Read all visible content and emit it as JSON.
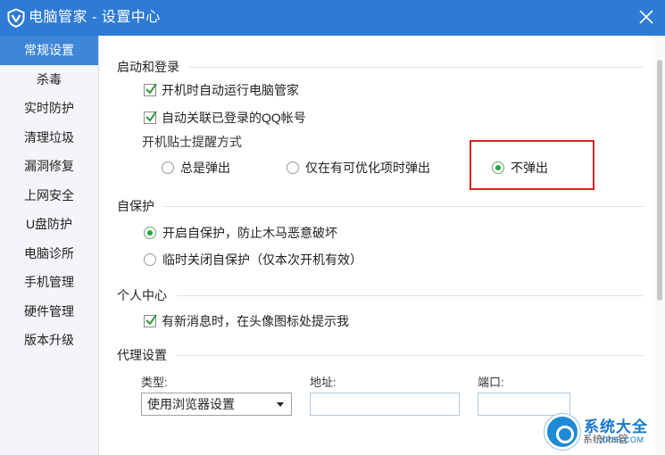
{
  "window": {
    "title": "电脑管家 - 设置中心",
    "title_color": "#2d7bd4",
    "logo_icon": "shield-v-icon",
    "close_icon": "close-icon"
  },
  "sidebar": {
    "active_color": "#3d86d8",
    "items": [
      {
        "label": "常规设置",
        "active": true
      },
      {
        "label": "杀毒"
      },
      {
        "label": "实时防护"
      },
      {
        "label": "清理垃圾"
      },
      {
        "label": "漏洞修复"
      },
      {
        "label": "上网安全"
      },
      {
        "label": "U盘防护"
      },
      {
        "label": "电脑诊所"
      },
      {
        "label": "手机管理"
      },
      {
        "label": "硬件管理"
      },
      {
        "label": "版本升级"
      }
    ]
  },
  "startup": {
    "heading": "启动和登录",
    "auto_run": {
      "label": "开机时自动运行电脑管家",
      "checked": true
    },
    "auto_link_qq": {
      "label": "自动关联已登录的QQ帐号",
      "checked": true
    },
    "popup_mode_label": "开机贴士提醒方式",
    "popup_options": [
      {
        "label": "总是弹出",
        "selected": false
      },
      {
        "label": "仅在有可优化项时弹出",
        "selected": false
      },
      {
        "label": "不弹出",
        "selected": true
      }
    ],
    "highlight_color": "#e02020"
  },
  "self_protect": {
    "heading": "自保护",
    "options": [
      {
        "label": "开启自保护，防止木马恶意破坏",
        "selected": true
      },
      {
        "label": "临时关闭自保护（仅本次开机有效）",
        "selected": false
      }
    ]
  },
  "personal": {
    "heading": "个人中心",
    "new_message_tip": {
      "label": "有新消息时，在头像图标处提示我",
      "checked": true
    }
  },
  "proxy": {
    "heading": "代理设置",
    "type_label": "类型:",
    "type_value": "使用浏览器设置",
    "address_label": "地址:",
    "address_value": "",
    "port_label": "端口:",
    "port_value": ""
  },
  "watermark": {
    "name": "系统大全",
    "url": "XP85.COM",
    "overlap_text": "系统bbs管"
  }
}
